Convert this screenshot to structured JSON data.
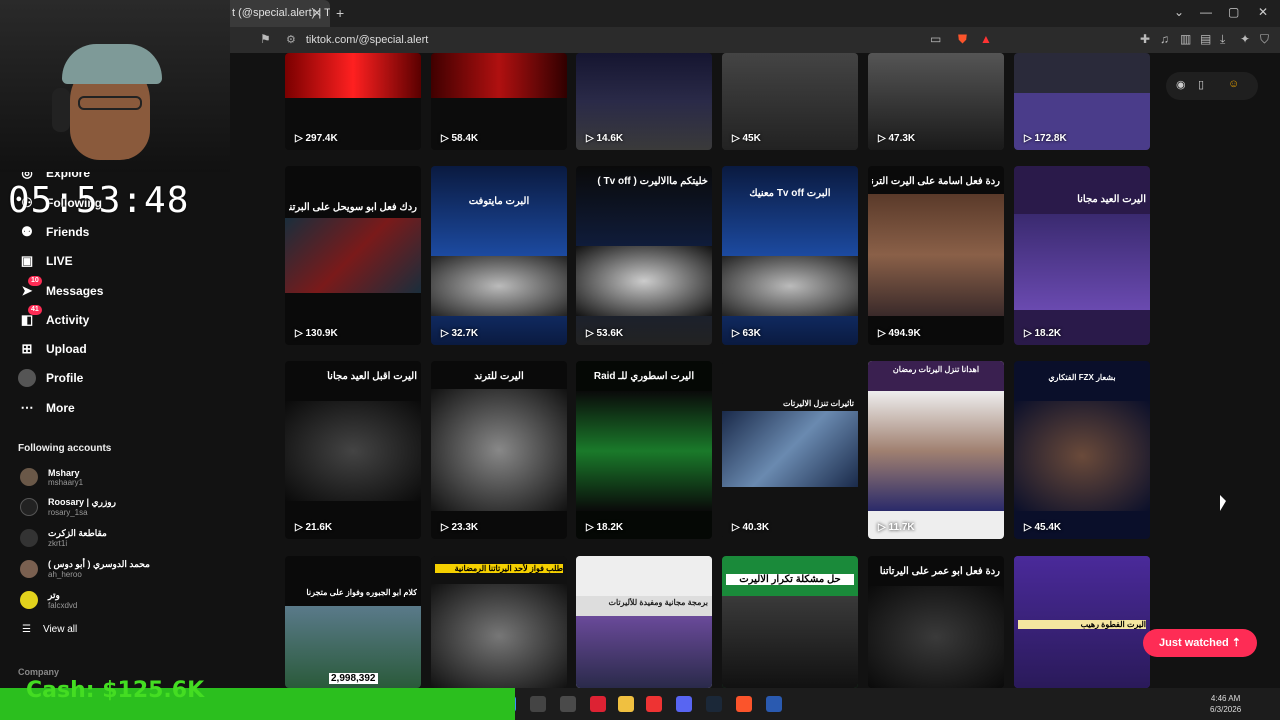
{
  "browser": {
    "tab_title": "t (@special.alert) | Tik",
    "url": "tiktok.com/@special.alert"
  },
  "timer": "05:53:48",
  "sidebar": {
    "nav": [
      {
        "label": "Explore",
        "icon": "compass-icon"
      },
      {
        "label": "Following",
        "icon": "following-icon"
      },
      {
        "label": "Friends",
        "icon": "friends-icon"
      },
      {
        "label": "LIVE",
        "icon": "live-icon"
      },
      {
        "label": "Messages",
        "icon": "message-icon",
        "badge": "10"
      },
      {
        "label": "Activity",
        "icon": "activity-icon",
        "badge": "41"
      },
      {
        "label": "Upload",
        "icon": "upload-icon"
      },
      {
        "label": "Profile",
        "icon": "profile-icon"
      },
      {
        "label": "More",
        "icon": "more-icon"
      }
    ],
    "following_title": "Following accounts",
    "accounts": [
      {
        "name": "Mshary",
        "handle": "mshaary1"
      },
      {
        "name": "Roosary | روزري",
        "handle": "rosary_1sa"
      },
      {
        "name": "مقاطعة الزكرت",
        "handle": "zkrt1i"
      },
      {
        "name": "محمد الدوسري ( أبو دوس )",
        "handle": "ah_heroo"
      },
      {
        "name": "وتر",
        "handle": "falcxdvd"
      }
    ],
    "view_all": "View all",
    "company": "Company"
  },
  "videos": [
    {
      "views": "297.4K",
      "caption": ""
    },
    {
      "views": "58.4K",
      "caption": ""
    },
    {
      "views": "14.6K",
      "caption": ""
    },
    {
      "views": "45K",
      "caption": ""
    },
    {
      "views": "47.3K",
      "caption": ""
    },
    {
      "views": "172.8K",
      "caption": ""
    },
    {
      "views": "130.9K",
      "caption": "ردك فعل ابو سويحل على البرتنا"
    },
    {
      "views": "32.7K",
      "caption": "البرت مايتوفت"
    },
    {
      "views": "53.6K",
      "caption": "خليتكم ماالاليرت ( Tv off )"
    },
    {
      "views": "63K",
      "caption": "البرت Tv off معنيك"
    },
    {
      "views": "494.9K",
      "caption": "ردة فعل اسامة على اليرت الترند"
    },
    {
      "views": "18.2K",
      "caption": "اليرت العيد مجانا"
    },
    {
      "views": "21.6K",
      "caption": "اليرت اقبل العيد مجاناً"
    },
    {
      "views": "23.3K",
      "caption": "اليرت للترند"
    },
    {
      "views": "18.2K",
      "caption": "اليرت اسطوري للـ Raid"
    },
    {
      "views": "40.3K",
      "caption": "تأثيرات تنزل الاليرتات"
    },
    {
      "views": "11.7K",
      "caption": "اهدانا تنزل اليرتات رمضان"
    },
    {
      "views": "45.4K",
      "caption": "بشعار FZX الفتكاري"
    },
    {
      "views": "2,998,392",
      "caption": "كلام ابو الجبوره وفواز على متجرنا"
    },
    {
      "views": "",
      "caption": "طلب فواز لأحد اليرتاتنا الرمضانية"
    },
    {
      "views": "",
      "caption": "برمجة مجانية ومفيدة للأليرتات"
    },
    {
      "views": "",
      "caption": "حل مشكلة تكرار الاليرت"
    },
    {
      "views": "",
      "caption": "ردة فعل ابو عمر على اليرتاتنا"
    },
    {
      "views": "",
      "caption": "اليرت الفطوة رهيب"
    }
  ],
  "just_watched": "Just watched",
  "cash_overlay": "Cash: $125.6K",
  "taskbar": {
    "time": "4:46 AM",
    "date": "6/3/2026"
  },
  "colors": {
    "accent": "#fe2c55",
    "background": "#121212"
  }
}
